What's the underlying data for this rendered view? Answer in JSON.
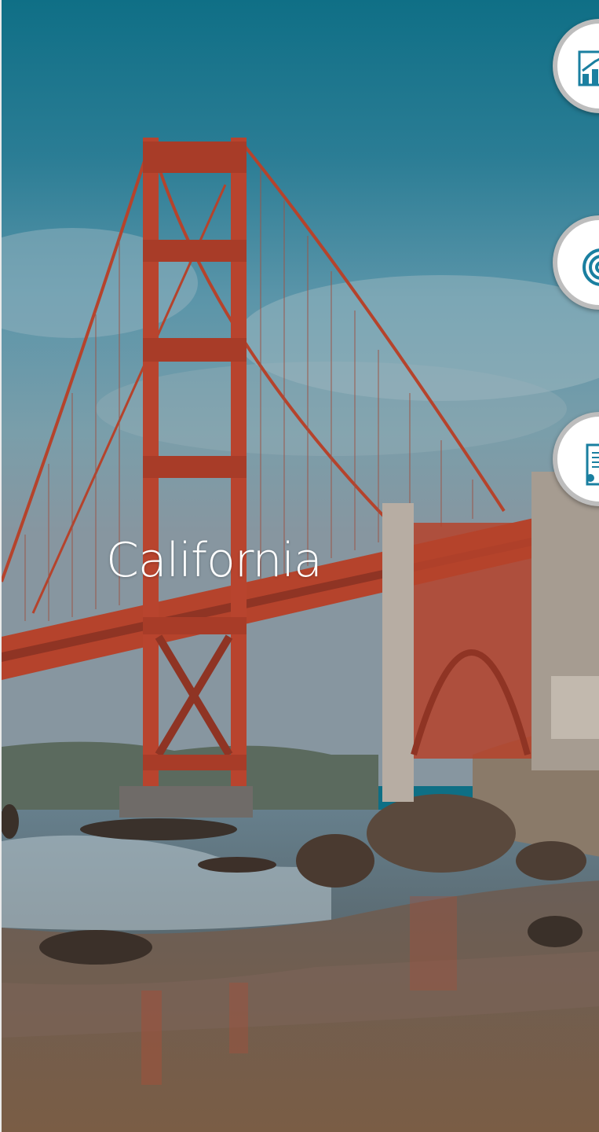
{
  "location": {
    "title": "California"
  },
  "actions": [
    {
      "icon": "chart-growth-icon"
    },
    {
      "icon": "target-rings-icon"
    },
    {
      "icon": "document-certificate-icon"
    }
  ],
  "colors": {
    "sky_top": "#0e6f85",
    "sky_mid": "#4e8fa6",
    "bridge": "#b5432c",
    "sand": "#6e5848",
    "icon": "#1a7fa0"
  }
}
